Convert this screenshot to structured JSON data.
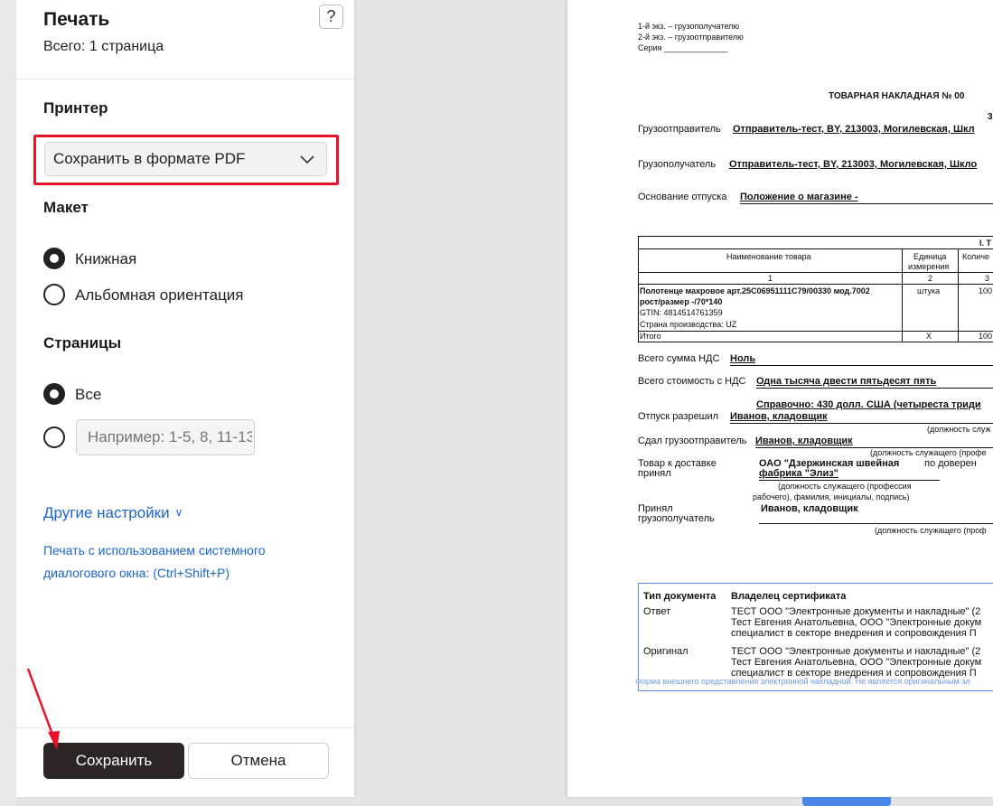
{
  "dialog": {
    "title": "Печать",
    "subtitle": "Всего: 1 страница",
    "help_label": "?",
    "printer": {
      "heading": "Принтер",
      "selected": "Сохранить в формате PDF"
    },
    "layout": {
      "heading": "Макет",
      "options": [
        "Книжная",
        "Альбомная ориентация"
      ],
      "selected_index": 0
    },
    "pages": {
      "heading": "Страницы",
      "option_all": "Все",
      "custom_placeholder": "Например: 1-5, 8, 11-13",
      "selected": "all"
    },
    "more_settings": "Другие настройки",
    "system_dialog_link_line1": "Печать с использованием системного",
    "system_dialog_link_line2": "диалогового окна: (Ctrl+Shift+P)",
    "save_label": "Сохранить",
    "cancel_label": "Отмена"
  },
  "colors": {
    "highlight_box": "#e8132b",
    "link": "#1a66c8",
    "save_button": "#2b2624",
    "preview_frame": "#5b8fd9"
  },
  "preview": {
    "copy1": "1-й экз. – грузополучателю",
    "copy2": "2-й экз. – грузоотправителю",
    "series": "Серия ______________",
    "doc_title": "ТОВАРНАЯ НАКЛАДНАЯ № 00",
    "top_right_fragment": "3",
    "shipper_label": "Грузоотправитель",
    "shipper_value": "Отправитель-тест, BY, 213003, Могилевская, Шкл",
    "consignee_label": "Грузополучатель",
    "consignee_value": "Отправитель-тест, BY, 213003, Могилевская, Шкло",
    "basis_label": "Основание отпуска",
    "basis_value": "Положение о магазине -",
    "section_title": "I. Т",
    "col_name": "Наименование товара",
    "col_unit_1": "Единица",
    "col_unit_2": "измерения",
    "col_qty": "Количе",
    "col_num_1": "1",
    "col_num_2": "2",
    "col_num_3": "3",
    "item_line1": "Полотенце махровое арт.25С06951111С79/00330 мод.7002",
    "item_line2": "рост/размер -/70*140",
    "item_gtin": "GTIN: 4814514761359",
    "item_country": "Страна производства: UZ",
    "item_unit": "штука",
    "item_qty": "100",
    "total_label": "Итого",
    "total_unit": "X",
    "total_qty": "100",
    "vat_label": "Всего сумма НДС",
    "vat_value": "Ноль",
    "cost_label": "Всего стоимость с НДС",
    "cost_value": "Одна тысяча двести пятьдесят пять",
    "reference": "Справочно: 430 долл. США (четыреста триди",
    "release_label": "Отпуск разрешил",
    "release_value": "Иванов, кладовщик",
    "position_note_1": "(должность служ",
    "handed_label": "Сдал грузоотправитель",
    "handed_value": "Иванов, кладовщик",
    "position_note_2": "(должность служащего (профе",
    "accepted_label_1": "Товар к доставке",
    "accepted_label_2": "принял",
    "accepted_value_1": "ОАО \"Дзержинская швейная",
    "accepted_value_2": "фабрика \"Элиз\"",
    "power_of_attorney": "по доверен",
    "position_note_3a": "(должность служащего (профессия",
    "position_note_3b": "рабочего), фамилия, инициалы, подпись)",
    "received_label_1": "Принял",
    "received_label_2": "грузополучатель",
    "received_value": "Иванов, кладовщик",
    "position_note_4": "(должность служащего (проф",
    "sig_col1": "Тип документа",
    "sig_col2": "Владелец сертификата",
    "sig_row1_type": "Ответ",
    "sig_row1_l1": "ТЕСТ ООО \"Электронные документы и накладные\" (2",
    "sig_row1_l2": "Тест Евгения Анатольевна, ООО \"Электронные докум",
    "sig_row1_l3": "специалист в секторе внедрения и сопровождения П",
    "sig_row2_type": "Оригинал",
    "sig_row2_l1": "ТЕСТ ООО \"Электронные документы и накладные\" (2",
    "sig_row2_l2": "Тест Евгения Анатольевна, ООО \"Электронные докум",
    "sig_row2_l3": "специалист в секторе внедрения и сопровождения П",
    "footnote": "Форма внешнего представления электронной накладной. Не является оригинальным эл"
  }
}
